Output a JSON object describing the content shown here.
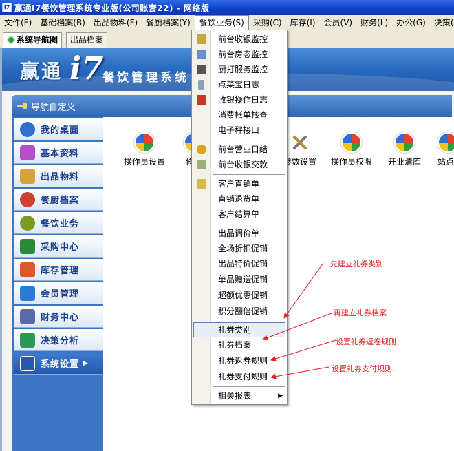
{
  "window": {
    "title": "赢通I7餐饮管理系统专业版(公司账套22) - 网络版",
    "icon_text": "I7"
  },
  "menubar": {
    "items": [
      {
        "label": "文件(F)"
      },
      {
        "label": "基础档案(B)"
      },
      {
        "label": "出品物料(F)"
      },
      {
        "label": "餐厨档案(Y)"
      },
      {
        "label": "餐饮业务(S)",
        "active": true
      },
      {
        "label": "采购(C)"
      },
      {
        "label": "库存(I)"
      },
      {
        "label": "会员(V)"
      },
      {
        "label": "财务(L)"
      },
      {
        "label": "办公(G)"
      },
      {
        "label": "决策(Q)"
      }
    ]
  },
  "tabs": [
    {
      "label": "系统导航图",
      "selected": true,
      "icon": "nav-globe-icon"
    },
    {
      "label": "出品档案",
      "selected": false
    }
  ],
  "banner": {
    "brand_main": "赢通",
    "brand_version": "i7",
    "brand_sub": "餐饮管理系统"
  },
  "nav_header": {
    "label": "导航自定义",
    "icon": "pin-icon"
  },
  "sidebar": {
    "items": [
      {
        "label": "我的桌面",
        "icon": "desktop-icon",
        "color": "#2f6fd0"
      },
      {
        "label": "基本资料",
        "icon": "puzzle-icon",
        "color": "#b34fc8"
      },
      {
        "label": "出品物料",
        "icon": "crate-icon",
        "color": "#d9a23a"
      },
      {
        "label": "餐厨档案",
        "icon": "tableware-icon",
        "color": "#d0402f"
      },
      {
        "label": "餐饮业务",
        "icon": "dish-icon",
        "color": "#7a9a22"
      },
      {
        "label": "采购中心",
        "icon": "truck-icon",
        "color": "#2a8a3a"
      },
      {
        "label": "库存管理",
        "icon": "house-icon",
        "color": "#d85a2a"
      },
      {
        "label": "会员管理",
        "icon": "member-card-icon",
        "color": "#2a7ad8"
      },
      {
        "label": "财务中心",
        "icon": "finance-icon",
        "color": "#5a6aa8"
      },
      {
        "label": "决策分析",
        "icon": "bar-chart-icon",
        "color": "#2a9a5a"
      },
      {
        "label": "系统设置",
        "icon": "monitor-icon",
        "color": "#2a5ab0",
        "selected": true
      }
    ]
  },
  "content": {
    "buttons": [
      {
        "label": "操作员设置",
        "icon": "windows-logo-icon"
      },
      {
        "label": "修改",
        "icon": "windows-logo-icon"
      },
      {
        "label": "参数设置",
        "icon": "tools-icon"
      },
      {
        "label": "操作员权限",
        "icon": "windows-logo-icon"
      },
      {
        "label": "开业清库",
        "icon": "windows-logo-icon"
      },
      {
        "label": "站点",
        "icon": "windows-logo-icon"
      }
    ]
  },
  "dropdown": {
    "items": [
      {
        "label": "前台收银监控",
        "icon": "register-icon"
      },
      {
        "label": "前台房态监控",
        "icon": "room-icon"
      },
      {
        "label": "厨打服务监控",
        "icon": "printer-icon"
      },
      {
        "label": "点菜宝日志",
        "icon": "handheld-icon"
      },
      {
        "label": "收银操作日志",
        "icon": "calendar-icon"
      },
      {
        "label": "消费帐单核查"
      },
      {
        "label": "电子秤接口"
      },
      {
        "label": "前台营业日结",
        "icon": "coins-icon"
      },
      {
        "label": "前台收银交款",
        "icon": "money-icon"
      },
      {
        "label": "客户直销单",
        "icon": "customer-icon"
      },
      {
        "label": "直销退货单"
      },
      {
        "label": "客户结算单"
      },
      {
        "label": "出品调价单"
      },
      {
        "label": "全场折扣促销"
      },
      {
        "label": "出品特价促销"
      },
      {
        "label": "单品赠送促销"
      },
      {
        "label": "超额优惠促销"
      },
      {
        "label": "积分翻倍促销"
      },
      {
        "label": "礼券类别",
        "hover": true
      },
      {
        "label": "礼券档案"
      },
      {
        "label": "礼券返券规则"
      },
      {
        "label": "礼券支付规则"
      },
      {
        "label": "相关报表",
        "submenu": true
      }
    ]
  },
  "annotations": [
    {
      "text": "先建立礼券类别"
    },
    {
      "text": "再建立礼券档案"
    },
    {
      "text": "设置礼券返卷规则"
    },
    {
      "text": "设置礼券支付规则."
    }
  ],
  "colors": {
    "title_bar": "#0d3fc4",
    "banner": "#2a6cc0",
    "annotation": "#e02020",
    "menu_highlight": "#e8eef7"
  }
}
